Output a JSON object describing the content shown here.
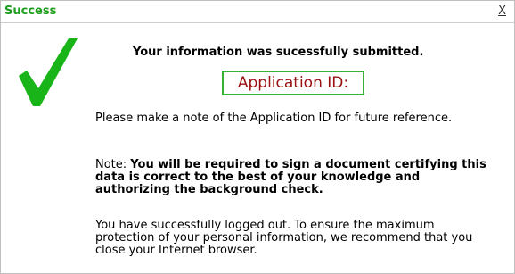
{
  "dialog": {
    "title": "Success",
    "close_label": "X"
  },
  "message": {
    "headline": "Your information was sucessfully submitted.",
    "application_id_label": "Application ID:",
    "note_line": "Please make a note of the Application ID for future reference.",
    "note_prefix": "Note: ",
    "note_bold": "You will be required to sign a document certifying this data is correct to the best of your knowledge and authorizing the background check.",
    "logout_notice": "You have successfully logged out. To ensure the maximum protection of your personal information, we recommend that you close your Internet browser."
  },
  "icons": {
    "success": "checkmark-icon"
  },
  "colors": {
    "title": "#1e9e1e",
    "checkmark": "#18b418",
    "id_border": "#35b135",
    "id_text": "#9a1010"
  }
}
